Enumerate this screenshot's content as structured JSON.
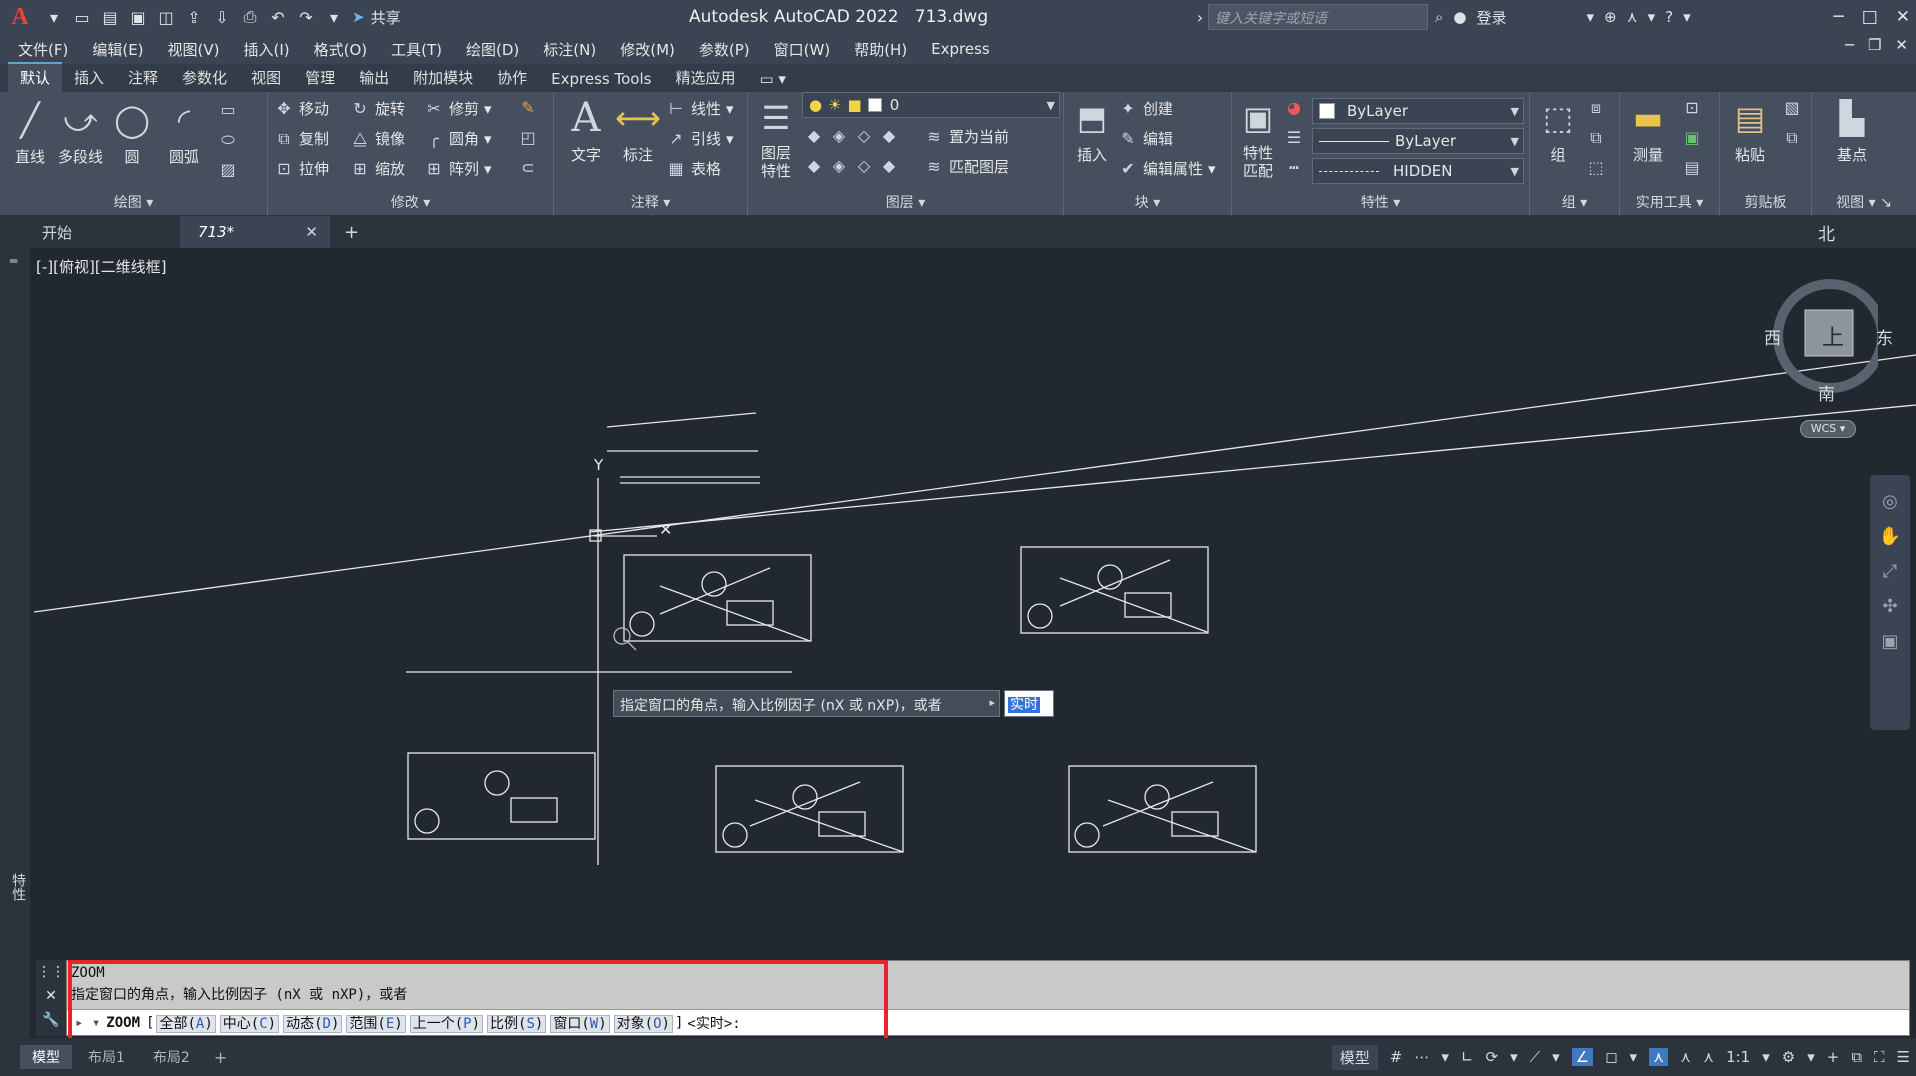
{
  "app": {
    "title": "Autodesk AutoCAD 2022",
    "filename": "713.dwg"
  },
  "qat": {
    "share_label": "共享",
    "search_placeholder": "键入关键字或短语",
    "login_label": "登录"
  },
  "menu": [
    "文件(F)",
    "编辑(E)",
    "视图(V)",
    "插入(I)",
    "格式(O)",
    "工具(T)",
    "绘图(D)",
    "标注(N)",
    "修改(M)",
    "参数(P)",
    "窗口(W)",
    "帮助(H)",
    "Express"
  ],
  "ribbon_tabs": [
    "默认",
    "插入",
    "注释",
    "参数化",
    "视图",
    "管理",
    "输出",
    "附加模块",
    "协作",
    "Express Tools",
    "精选应用"
  ],
  "ribbon": {
    "draw": {
      "title": "绘图",
      "line": "直线",
      "polyline": "多段线",
      "circle": "圆",
      "arc": "圆弧"
    },
    "modify": {
      "title": "修改",
      "move": "移动",
      "rotate": "旋转",
      "trim": "修剪",
      "copy": "复制",
      "mirror": "镜像",
      "fillet": "圆角",
      "stretch": "拉伸",
      "scale": "缩放",
      "array": "阵列"
    },
    "annotation": {
      "title": "注释",
      "text": "文字",
      "dimension": "标注",
      "linear": "线性",
      "leader": "引线",
      "table": "表格"
    },
    "layers": {
      "title": "图层",
      "layer_props": "图层\n特性",
      "layer_value": "0",
      "make_current": "置为当前",
      "match_layer": "匹配图层"
    },
    "block": {
      "title": "块",
      "insert": "插入",
      "create": "创建",
      "edit": "编辑",
      "edit_attr": "编辑属性"
    },
    "properties": {
      "title": "特性",
      "match": "特性\n匹配",
      "color": "ByLayer",
      "lineweight": "ByLayer",
      "linetype": "HIDDEN"
    },
    "groups": {
      "title": "组",
      "group": "组"
    },
    "utilities": {
      "title": "实用工具",
      "measure": "测量"
    },
    "clipboard": {
      "title": "剪贴板",
      "paste": "粘贴"
    },
    "view": {
      "title": "视图",
      "base": "基点"
    }
  },
  "doc_tabs": [
    "开始",
    "713*"
  ],
  "viewport": {
    "label": "[-][俯视][二维线框]",
    "side_label": "特性"
  },
  "viewcube": {
    "north": "北",
    "south": "南",
    "east": "东",
    "west": "西",
    "top": "上",
    "wcs": "WCS"
  },
  "tooltip": {
    "text": "指定窗口的角点，输入比例因子 (nX 或 nXP)，或者",
    "input_value": "实时"
  },
  "command": {
    "line1": "ZOOM",
    "line2": "指定窗口的角点，输入比例因子 (nX 或 nXP)，或者",
    "cmd": "ZOOM",
    "options": [
      {
        "label": "全部",
        "key": "A"
      },
      {
        "label": "中心",
        "key": "C"
      },
      {
        "label": "动态",
        "key": "D"
      },
      {
        "label": "范围",
        "key": "E"
      },
      {
        "label": "上一个",
        "key": "P"
      },
      {
        "label": "比例",
        "key": "S"
      },
      {
        "label": "窗口",
        "key": "W"
      },
      {
        "label": "对象",
        "key": "O"
      }
    ],
    "default": "<实时>:"
  },
  "layout_tabs": [
    "模型",
    "布局1",
    "布局2"
  ],
  "status": {
    "model_label": "模型",
    "scale": "1:1"
  }
}
